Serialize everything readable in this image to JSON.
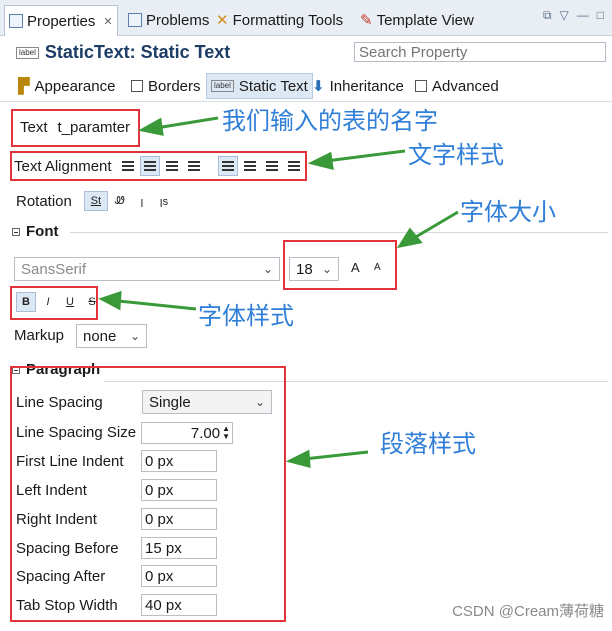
{
  "tabs": [
    {
      "label": "Properties",
      "close": "✕"
    },
    {
      "label": "Problems"
    },
    {
      "label": "Formatting Tools"
    },
    {
      "label": "Template View"
    }
  ],
  "header": {
    "title": "StaticText: Static Text",
    "icon_text": "label",
    "search_placeholder": "Search Property"
  },
  "subtabs": [
    "Appearance",
    "Borders",
    "Static Text",
    "Inheritance",
    "Advanced"
  ],
  "text_row": {
    "label": "Text",
    "value": "t_paramter"
  },
  "alignment": {
    "label": "Text Alignment"
  },
  "rotation": {
    "label": "Rotation",
    "st": "St",
    "glyphs": [
      "Ꮺ",
      "ꞁ",
      "ꞁs"
    ]
  },
  "font": {
    "section": "Font",
    "family": "SansSerif",
    "size": "18",
    "grow": "A",
    "shrink": "A",
    "styles": [
      "B",
      "I",
      "U",
      "S"
    ]
  },
  "markup": {
    "label": "Markup",
    "value": "none"
  },
  "paragraph": {
    "section": "Paragraph",
    "line_spacing": {
      "label": "Line Spacing",
      "value": "Single"
    },
    "line_spacing_size": {
      "label": "Line Spacing Size",
      "value": "7.00"
    },
    "fields": [
      {
        "label": "First Line Indent",
        "value": "0 px"
      },
      {
        "label": "Left Indent",
        "value": "0 px"
      },
      {
        "label": "Right Indent",
        "value": "0 px"
      },
      {
        "label": "Spacing Before",
        "value": "15 px"
      },
      {
        "label": "Spacing After",
        "value": "0 px"
      },
      {
        "label": "Tab Stop Width",
        "value": "40 px"
      }
    ]
  },
  "annotations": [
    "我们输入的表的名字",
    "文字样式",
    "字体大小",
    "字体样式",
    "段落样式"
  ],
  "watermark": "CSDN @Cream薄荷糖",
  "colors": {
    "annotation": "#2f7ed8",
    "highlight_box": "#e1343a",
    "arrow": "#3a9a3a",
    "title": "#1d3c66"
  }
}
